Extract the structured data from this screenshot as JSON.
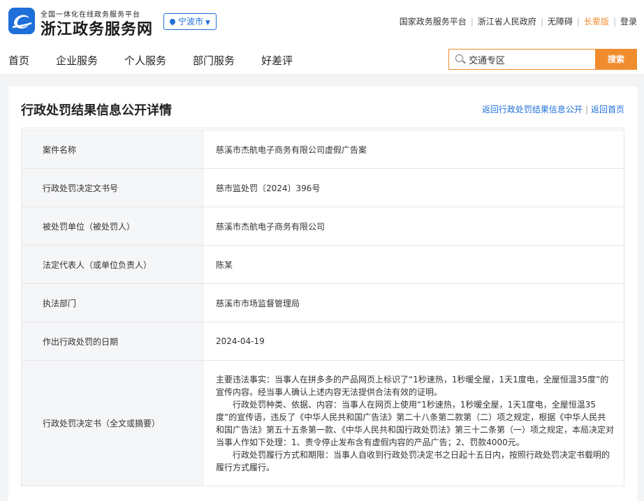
{
  "header": {
    "logo_sub": "全国一体化在线政务服务平台",
    "logo_main": "浙江政务服务网",
    "city": "宁波市",
    "top_links": [
      {
        "label": "国家政务服务平台",
        "accent": false
      },
      {
        "label": "浙江省人民政府",
        "accent": false
      },
      {
        "label": "无障碍",
        "accent": false
      },
      {
        "label": "长辈版",
        "accent": true
      },
      {
        "label": "登录",
        "accent": false
      }
    ]
  },
  "nav": [
    "首页",
    "企业服务",
    "个人服务",
    "部门服务",
    "好差评"
  ],
  "search": {
    "value": "交通专区",
    "button": "搜索"
  },
  "page": {
    "title": "行政处罚结果信息公开详情",
    "link_back": "返回行政处罚结果信息公开",
    "link_home": "返回首页"
  },
  "rows": [
    {
      "label": "案件名称",
      "value": "慈溪市杰航电子商务有限公司虚假广告案"
    },
    {
      "label": "行政处罚决定文书号",
      "value": "慈市监处罚〔2024〕396号"
    },
    {
      "label": "被处罚单位（被处罚人）",
      "value": "慈溪市杰航电子商务有限公司"
    },
    {
      "label": "法定代表人（或单位负责人）",
      "value": "陈某"
    },
    {
      "label": "执法部门",
      "value": "慈溪市市场监督管理局"
    },
    {
      "label": "作出行政处罚的日期",
      "value": "2024-04-19"
    }
  ],
  "decision": {
    "label": "行政处罚决定书（全文或摘要）",
    "p1": "主要违法事实：当事人在拼多多的产品网页上标识了“1秒速热，1秒暖全屋，1天1度电，全屋恒温35度”的宣传内容。经当事人确认上述内容无法提供合法有效的证明。",
    "p2": "行政处罚种类、依据、内容：当事人在网页上使用“1秒速热，1秒暖全屋，1天1度电，全屋恒温35度”的宣传语，违反了《中华人民共和国广告法》第二十八条第二款第（二）项之规定，根据《中华人民共和国广告法》第五十五条第一款、《中华人民共和国行政处罚法》第三十二条第（一）项之规定，本局决定对当事人作如下处理：1、责令停止发布含有虚假内容的产品广告；2、罚款4000元。",
    "p3": "行政处罚履行方式和期限：当事人自收到行政处罚决定书之日起十五日内，按照行政处罚决定书载明的履行方式履行。"
  },
  "colors": {
    "brand_blue": "#1e6fd9",
    "accent_orange": "#f08c2e"
  }
}
